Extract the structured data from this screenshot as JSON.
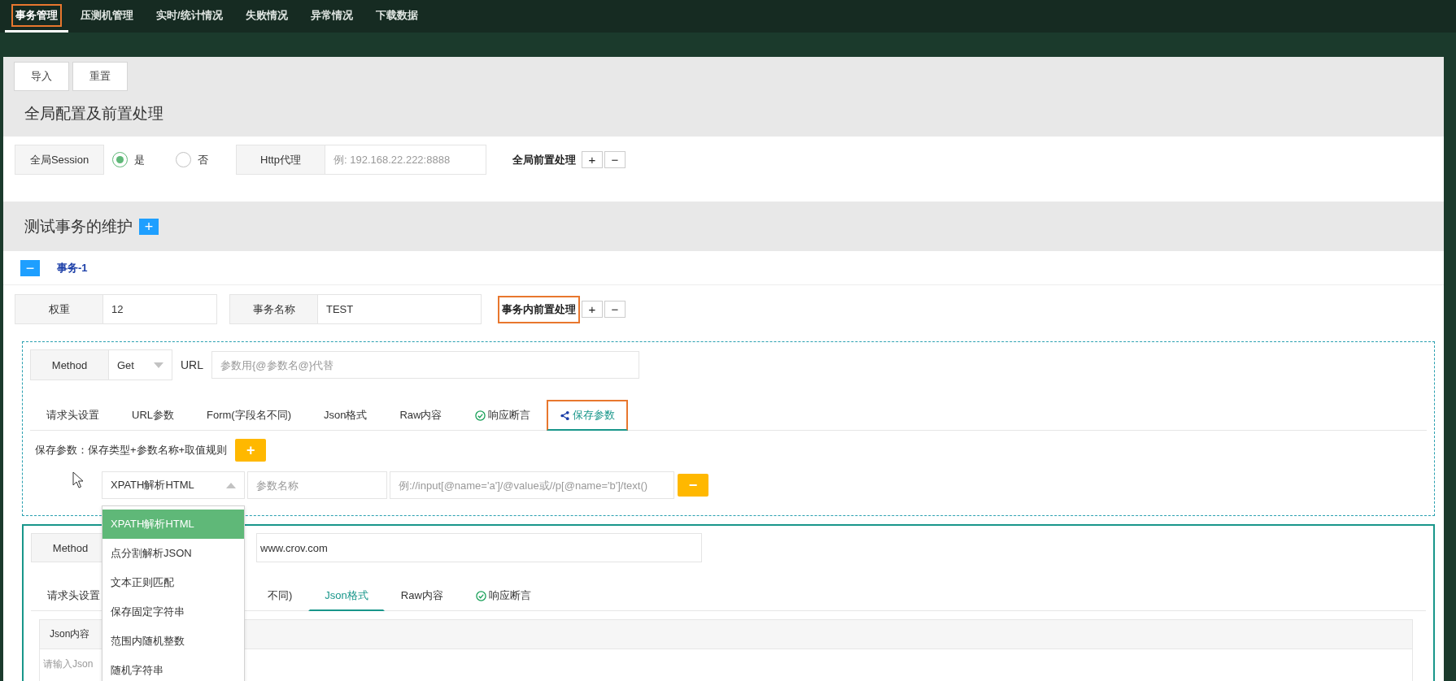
{
  "nav": [
    {
      "label": "事务管理",
      "selected": true,
      "annotated": true
    },
    {
      "label": "压测机管理",
      "selected": false,
      "annotated": false
    },
    {
      "label": "实时/统计情况",
      "selected": false,
      "annotated": false
    },
    {
      "label": "失败情况",
      "selected": false,
      "annotated": false
    },
    {
      "label": "异常情况",
      "selected": false,
      "annotated": false
    },
    {
      "label": "下载数据",
      "selected": false,
      "annotated": false
    }
  ],
  "toolbar": [
    "导入",
    "重置"
  ],
  "global_section": {
    "title": "全局配置及前置处理",
    "session_label": "全局Session",
    "session_options": [
      {
        "label": "是",
        "selected": true
      },
      {
        "label": "否",
        "selected": false
      }
    ],
    "proxy_label": "Http代理",
    "proxy_placeholder": "例: 192.168.22.222:8888",
    "preprocess_label": "全局前置处理",
    "add": "+",
    "remove": "−"
  },
  "transactions_section": {
    "title": "测试事务的维护",
    "add": "+"
  },
  "transaction": {
    "collapse": "−",
    "name": "事务-1",
    "weight_label": "权重",
    "weight": "12",
    "name_label": "事务名称",
    "name_value": "TEST",
    "preprocess_label": "事务内前置处理",
    "preprocess_annotated": true,
    "add": "+",
    "remove": "−"
  },
  "requests": [
    {
      "focused": false,
      "method_label": "Method",
      "method": "Get",
      "url_label": "URL",
      "url_placeholder": "参数用{@参数名@}代替",
      "tabs": [
        {
          "label": "请求头设置",
          "kind": "plain",
          "selected": false,
          "annotated": false
        },
        {
          "label": "URL参数",
          "kind": "plain",
          "selected": false,
          "annotated": false
        },
        {
          "label": "Form(字段名不同)",
          "kind": "plain",
          "selected": false,
          "annotated": false
        },
        {
          "label": "Json格式",
          "kind": "plain",
          "selected": false,
          "annotated": false
        },
        {
          "label": "Raw内容",
          "kind": "plain",
          "selected": false,
          "annotated": false
        },
        {
          "label": "响应断言",
          "kind": "check",
          "selected": false,
          "annotated": false
        },
        {
          "label": "保存参数",
          "kind": "share",
          "selected": true,
          "annotated": true
        }
      ],
      "save_params": {
        "label": "保存参数：保存类型+参数名称+取值规则",
        "add": "+",
        "type_value": "XPATH解析HTML",
        "open": true,
        "name_placeholder": "参数名称",
        "rule_placeholder": "例://input[@name='a']/@value或//p[@name='b']/text()",
        "remove": "−",
        "options": [
          {
            "label": "XPATH解析HTML",
            "selected": true
          },
          {
            "label": "点分割解析JSON",
            "selected": false
          },
          {
            "label": "文本正则匹配",
            "selected": false
          },
          {
            "label": "保存固定字符串",
            "selected": false
          },
          {
            "label": "范围内随机整数",
            "selected": false
          },
          {
            "label": "随机字符串",
            "selected": false
          }
        ]
      }
    },
    {
      "focused": true,
      "method_label": "Method",
      "url_value": "www.crov.com",
      "tabs": [
        {
          "label": "请求头设置",
          "kind": "plain",
          "selected": false,
          "annotated": false
        },
        {
          "label": "不同)",
          "kind": "plain",
          "selected": false,
          "annotated": false
        },
        {
          "label": "Json格式",
          "kind": "plain",
          "selected": true,
          "annotated": false
        },
        {
          "label": "Raw内容",
          "kind": "plain",
          "selected": false,
          "annotated": false
        },
        {
          "label": "响应断言",
          "kind": "check",
          "selected": false,
          "annotated": false
        }
      ],
      "json_table": {
        "header": "Json内容",
        "placeholder": "请输入Json"
      }
    }
  ]
}
